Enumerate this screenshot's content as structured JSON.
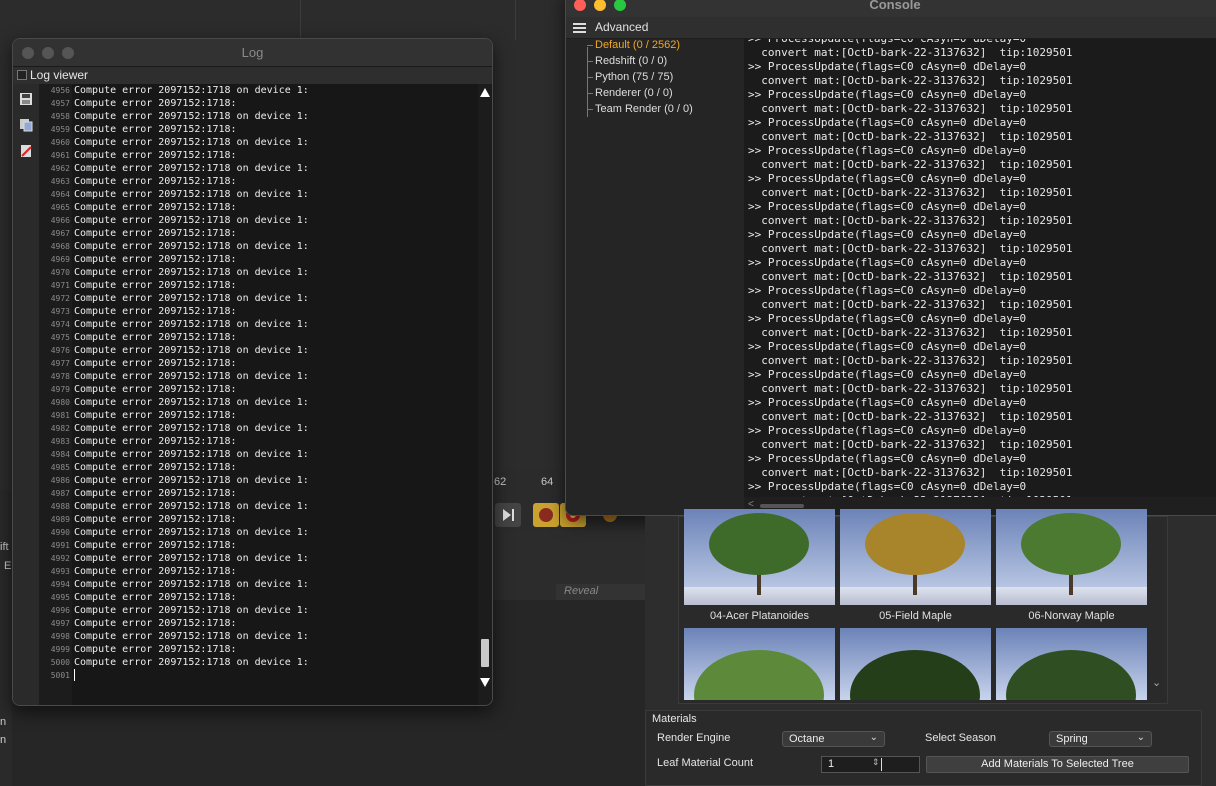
{
  "log_window": {
    "title": "Log",
    "viewer_label": "Log viewer",
    "lines": [
      {
        "num": "4956",
        "text": "Compute error 2097152:1718 on device 1:"
      },
      {
        "num": "4957",
        "text": "Compute error 2097152:1718:"
      },
      {
        "num": "4958",
        "text": "Compute error 2097152:1718 on device 1:"
      },
      {
        "num": "4959",
        "text": "Compute error 2097152:1718:"
      },
      {
        "num": "4960",
        "text": "Compute error 2097152:1718 on device 1:"
      },
      {
        "num": "4961",
        "text": "Compute error 2097152:1718:"
      },
      {
        "num": "4962",
        "text": "Compute error 2097152:1718 on device 1:"
      },
      {
        "num": "4963",
        "text": "Compute error 2097152:1718:"
      },
      {
        "num": "4964",
        "text": "Compute error 2097152:1718 on device 1:"
      },
      {
        "num": "4965",
        "text": "Compute error 2097152:1718:"
      },
      {
        "num": "4966",
        "text": "Compute error 2097152:1718 on device 1:"
      },
      {
        "num": "4967",
        "text": "Compute error 2097152:1718:"
      },
      {
        "num": "4968",
        "text": "Compute error 2097152:1718 on device 1:"
      },
      {
        "num": "4969",
        "text": "Compute error 2097152:1718:"
      },
      {
        "num": "4970",
        "text": "Compute error 2097152:1718 on device 1:"
      },
      {
        "num": "4971",
        "text": "Compute error 2097152:1718:"
      },
      {
        "num": "4972",
        "text": "Compute error 2097152:1718 on device 1:"
      },
      {
        "num": "4973",
        "text": "Compute error 2097152:1718:"
      },
      {
        "num": "4974",
        "text": "Compute error 2097152:1718 on device 1:"
      },
      {
        "num": "4975",
        "text": "Compute error 2097152:1718:"
      },
      {
        "num": "4976",
        "text": "Compute error 2097152:1718 on device 1:"
      },
      {
        "num": "4977",
        "text": "Compute error 2097152:1718:"
      },
      {
        "num": "4978",
        "text": "Compute error 2097152:1718 on device 1:"
      },
      {
        "num": "4979",
        "text": "Compute error 2097152:1718:"
      },
      {
        "num": "4980",
        "text": "Compute error 2097152:1718 on device 1:"
      },
      {
        "num": "4981",
        "text": "Compute error 2097152:1718:"
      },
      {
        "num": "4982",
        "text": "Compute error 2097152:1718 on device 1:"
      },
      {
        "num": "4983",
        "text": "Compute error 2097152:1718:"
      },
      {
        "num": "4984",
        "text": "Compute error 2097152:1718 on device 1:"
      },
      {
        "num": "4985",
        "text": "Compute error 2097152:1718:"
      },
      {
        "num": "4986",
        "text": "Compute error 2097152:1718 on device 1:"
      },
      {
        "num": "4987",
        "text": "Compute error 2097152:1718:"
      },
      {
        "num": "4988",
        "text": "Compute error 2097152:1718 on device 1:"
      },
      {
        "num": "4989",
        "text": "Compute error 2097152:1718:"
      },
      {
        "num": "4990",
        "text": "Compute error 2097152:1718 on device 1:"
      },
      {
        "num": "4991",
        "text": "Compute error 2097152:1718:"
      },
      {
        "num": "4992",
        "text": "Compute error 2097152:1718 on device 1:"
      },
      {
        "num": "4993",
        "text": "Compute error 2097152:1718:"
      },
      {
        "num": "4994",
        "text": "Compute error 2097152:1718 on device 1:"
      },
      {
        "num": "4995",
        "text": "Compute error 2097152:1718:"
      },
      {
        "num": "4996",
        "text": "Compute error 2097152:1718 on device 1:"
      },
      {
        "num": "4997",
        "text": "Compute error 2097152:1718:"
      },
      {
        "num": "4998",
        "text": "Compute error 2097152:1718 on device 1:"
      },
      {
        "num": "4999",
        "text": "Compute error 2097152:1718:"
      },
      {
        "num": "5000",
        "text": "Compute error 2097152:1718 on device 1:"
      },
      {
        "num": "5001",
        "text": ""
      }
    ]
  },
  "console_window": {
    "title": "Console",
    "menu_label": "Advanced",
    "tree": [
      {
        "label": "Default (0 / 2562)",
        "active": true
      },
      {
        "label": "Redshift (0 / 0)",
        "active": false
      },
      {
        "label": "Python (75 / 75)",
        "active": false
      },
      {
        "label": "Renderer (0 / 0)",
        "active": false
      },
      {
        "label": "Team Render  (0 / 0)",
        "active": false
      }
    ],
    "output": [
      ">> ProcessUpdate(flags=C0 cAsyn=0 dDelay=0",
      "  convert mat:[OctD-bark-22-3137632]  tip:1029501",
      ">> ProcessUpdate(flags=C0 cAsyn=0 dDelay=0",
      "  convert mat:[OctD-bark-22-3137632]  tip:1029501",
      ">> ProcessUpdate(flags=C0 cAsyn=0 dDelay=0",
      "  convert mat:[OctD-bark-22-3137632]  tip:1029501",
      ">> ProcessUpdate(flags=C0 cAsyn=0 dDelay=0",
      "  convert mat:[OctD-bark-22-3137632]  tip:1029501",
      ">> ProcessUpdate(flags=C0 cAsyn=0 dDelay=0",
      "  convert mat:[OctD-bark-22-3137632]  tip:1029501",
      ">> ProcessUpdate(flags=C0 cAsyn=0 dDelay=0",
      "  convert mat:[OctD-bark-22-3137632]  tip:1029501",
      ">> ProcessUpdate(flags=C0 cAsyn=0 dDelay=0",
      "  convert mat:[OctD-bark-22-3137632]  tip:1029501",
      ">> ProcessUpdate(flags=C0 cAsyn=0 dDelay=0",
      "  convert mat:[OctD-bark-22-3137632]  tip:1029501",
      ">> ProcessUpdate(flags=C0 cAsyn=0 dDelay=0",
      "  convert mat:[OctD-bark-22-3137632]  tip:1029501",
      ">> ProcessUpdate(flags=C0 cAsyn=0 dDelay=0",
      "  convert mat:[OctD-bark-22-3137632]  tip:1029501",
      ">> ProcessUpdate(flags=C0 cAsyn=0 dDelay=0",
      "  convert mat:[OctD-bark-22-3137632]  tip:1029501",
      ">> ProcessUpdate(flags=C0 cAsyn=0 dDelay=0",
      "  convert mat:[OctD-bark-22-3137632]  tip:1029501",
      ">> ProcessUpdate(flags=C0 cAsyn=0 dDelay=0",
      "  convert mat:[OctD-bark-22-3137632]  tip:1029501",
      ">> ProcessUpdate(flags=C0 cAsyn=0 dDelay=0",
      "  convert mat:[OctD-bark-22-3137632]  tip:1029501",
      ">> ProcessUpdate(flags=C0 cAsyn=0 dDelay=0",
      "  convert mat:[OctD-bark-22-3137632]  tip:1029501",
      ">> ProcessUpdate(flags=C0 cAsyn=0 dDelay=0",
      "  convert mat:[OctD-bark-22-3137632]  tip:1029501",
      ">> ProcessUpdate(flags=C0 cAsyn=0 dDelay=0",
      "  convert mat:[OctD-bark-22-3137632]  tip:1029501",
      ">> ProcessUpdate(flags=C0 cAsyn=0 dDelay=0",
      "  convert mat:[OctD-bark-22-3137632]  tip:1029501",
      ">> ProcessUpdate(flags=C0 cAsyn=0 dDelay=0"
    ],
    "hscroll_arrow": "<"
  },
  "timeline": {
    "frame_a": "62",
    "frame_b": "64"
  },
  "reveal_label": "Reveal",
  "left_fragments": [
    "ift",
    "E",
    "n",
    "n"
  ],
  "tree_assets": [
    {
      "name": "04-Acer Platanoides",
      "canopy": "#3f6b2a"
    },
    {
      "name": "05-Field Maple",
      "canopy": "#a8842a"
    },
    {
      "name": "06-Norway Maple",
      "canopy": "#4c7a30"
    },
    {
      "name": "",
      "canopy": "#5d8a3a"
    },
    {
      "name": "",
      "canopy": "#243e1a"
    },
    {
      "name": "",
      "canopy": "#2f4f22"
    }
  ],
  "materials": {
    "heading": "Materials",
    "render_engine_label": "Render Engine",
    "render_engine_value": "Octane",
    "season_label": "Select Season",
    "season_value": "Spring",
    "leaf_count_label": "Leaf Material Count",
    "leaf_count_value": "1",
    "add_button": "Add Materials To Selected Tree"
  },
  "colors": {
    "accent_active": "#f5a623",
    "close": "#fe5f57",
    "minimize": "#febc2e",
    "zoom": "#28c840"
  }
}
